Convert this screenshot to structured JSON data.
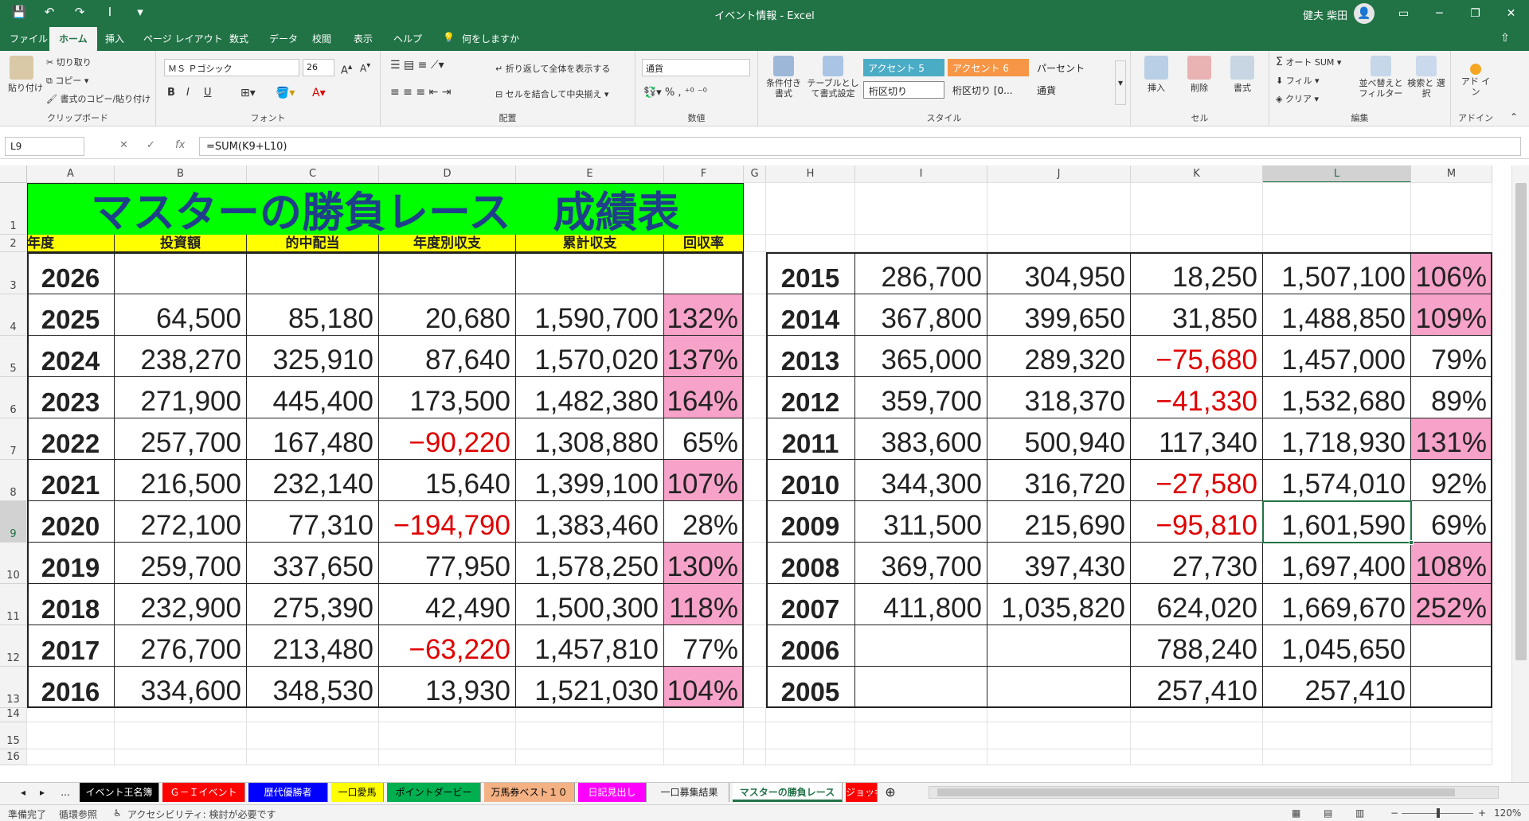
{
  "window": {
    "title": "イベント情報 - Excel",
    "user": "健夫 柴田",
    "qat": [
      "💾",
      "↶",
      "↷",
      "I",
      "▾"
    ],
    "buttons": [
      "▭",
      "─",
      "❐",
      "✕"
    ]
  },
  "tabs": [
    "ファイル",
    "ホーム",
    "挿入",
    "ページ レイアウト",
    "数式",
    "データ",
    "校閲",
    "表示",
    "ヘルプ",
    "何をしますか"
  ],
  "active_tab": "ホーム",
  "ribbon": {
    "clipboard": {
      "label": "クリップボード",
      "paste": "貼り付け",
      "cut": "切り取り",
      "copy": "コピー",
      "format_painter": "書式のコピー/貼り付け"
    },
    "font": {
      "label": "フォント",
      "name": "ＭＳ Ｐゴシック",
      "size": "26"
    },
    "alignment": {
      "label": "配置",
      "wrap": "折り返して全体を表示する",
      "merge": "セルを結合して中央揃え"
    },
    "number": {
      "label": "数値",
      "format": "通貨"
    },
    "styles": {
      "label": "スタイル",
      "conditional": "条件付き書式",
      "table": "テーブルとして書式設定",
      "cells": [
        "アクセント 5",
        "アクセント 6",
        "パーセント",
        "桁区切り",
        "桁区切り [0...",
        "通貨"
      ]
    },
    "cells": {
      "label": "セル",
      "insert": "挿入",
      "delete": "削除",
      "format": "書式"
    },
    "editing": {
      "label": "編集",
      "autosum": "オート SUM",
      "fill": "フィル",
      "clear": "クリア",
      "sort": "並べ替えと フィルター",
      "find": "検索と 選択"
    },
    "addin": {
      "label": "アドイン",
      "name": "アド イン"
    }
  },
  "formula_bar": {
    "name_box": "L9",
    "formula": "=SUM(K9+L10)",
    "fx": "fx"
  },
  "columns": [
    "A",
    "B",
    "C",
    "D",
    "E",
    "F",
    "G",
    "H",
    "I",
    "J",
    "K",
    "L",
    "M"
  ],
  "rows": [
    "1",
    "2",
    "3",
    "4",
    "5",
    "6",
    "7",
    "8",
    "9",
    "10",
    "11",
    "12",
    "13",
    "14",
    "15",
    "16"
  ],
  "sheet": {
    "title": "マスターの勝負レース　成績表",
    "headers": [
      "年度",
      "投資額",
      "的中配当",
      "年度別収支",
      "累計収支",
      "回収率"
    ],
    "left_rows": [
      {
        "year": "2026",
        "inv": "",
        "pay": "",
        "bal": "",
        "cum": "",
        "rate": "",
        "neg": false,
        "pink": false
      },
      {
        "year": "2025",
        "inv": "64,500",
        "pay": "85,180",
        "bal": "20,680",
        "cum": "1,590,700",
        "rate": "132%",
        "neg": false,
        "pink": true
      },
      {
        "year": "2024",
        "inv": "238,270",
        "pay": "325,910",
        "bal": "87,640",
        "cum": "1,570,020",
        "rate": "137%",
        "neg": false,
        "pink": true
      },
      {
        "year": "2023",
        "inv": "271,900",
        "pay": "445,400",
        "bal": "173,500",
        "cum": "1,482,380",
        "rate": "164%",
        "neg": false,
        "pink": true
      },
      {
        "year": "2022",
        "inv": "257,700",
        "pay": "167,480",
        "bal": "−90,220",
        "cum": "1,308,880",
        "rate": "65%",
        "neg": true,
        "pink": false
      },
      {
        "year": "2021",
        "inv": "216,500",
        "pay": "232,140",
        "bal": "15,640",
        "cum": "1,399,100",
        "rate": "107%",
        "neg": false,
        "pink": true
      },
      {
        "year": "2020",
        "inv": "272,100",
        "pay": "77,310",
        "bal": "−194,790",
        "cum": "1,383,460",
        "rate": "28%",
        "neg": true,
        "pink": false
      },
      {
        "year": "2019",
        "inv": "259,700",
        "pay": "337,650",
        "bal": "77,950",
        "cum": "1,578,250",
        "rate": "130%",
        "neg": false,
        "pink": true
      },
      {
        "year": "2018",
        "inv": "232,900",
        "pay": "275,390",
        "bal": "42,490",
        "cum": "1,500,300",
        "rate": "118%",
        "neg": false,
        "pink": true
      },
      {
        "year": "2017",
        "inv": "276,700",
        "pay": "213,480",
        "bal": "−63,220",
        "cum": "1,457,810",
        "rate": "77%",
        "neg": true,
        "pink": false
      },
      {
        "year": "2016",
        "inv": "334,600",
        "pay": "348,530",
        "bal": "13,930",
        "cum": "1,521,030",
        "rate": "104%",
        "neg": false,
        "pink": true
      }
    ],
    "right_rows": [
      {
        "year": "2015",
        "inv": "286,700",
        "pay": "304,950",
        "bal": "18,250",
        "cum": "1,507,100",
        "rate": "106%",
        "neg": false,
        "pink": true
      },
      {
        "year": "2014",
        "inv": "367,800",
        "pay": "399,650",
        "bal": "31,850",
        "cum": "1,488,850",
        "rate": "109%",
        "neg": false,
        "pink": true
      },
      {
        "year": "2013",
        "inv": "365,000",
        "pay": "289,320",
        "bal": "−75,680",
        "cum": "1,457,000",
        "rate": "79%",
        "neg": true,
        "pink": false
      },
      {
        "year": "2012",
        "inv": "359,700",
        "pay": "318,370",
        "bal": "−41,330",
        "cum": "1,532,680",
        "rate": "89%",
        "neg": true,
        "pink": false
      },
      {
        "year": "2011",
        "inv": "383,600",
        "pay": "500,940",
        "bal": "117,340",
        "cum": "1,718,930",
        "rate": "131%",
        "neg": false,
        "pink": true
      },
      {
        "year": "2010",
        "inv": "344,300",
        "pay": "316,720",
        "bal": "−27,580",
        "cum": "1,574,010",
        "rate": "92%",
        "neg": true,
        "pink": false
      },
      {
        "year": "2009",
        "inv": "311,500",
        "pay": "215,690",
        "bal": "−95,810",
        "cum": "1,601,590",
        "rate": "69%",
        "neg": true,
        "pink": false
      },
      {
        "year": "2008",
        "inv": "369,700",
        "pay": "397,430",
        "bal": "27,730",
        "cum": "1,697,400",
        "rate": "108%",
        "neg": false,
        "pink": true
      },
      {
        "year": "2007",
        "inv": "411,800",
        "pay": "1,035,820",
        "bal": "624,020",
        "cum": "1,669,670",
        "rate": "252%",
        "neg": false,
        "pink": true
      },
      {
        "year": "2006",
        "inv": "",
        "pay": "",
        "bal": "788,240",
        "cum": "1,045,650",
        "rate": "",
        "neg": false,
        "pink": false
      },
      {
        "year": "2005",
        "inv": "",
        "pay": "",
        "bal": "257,410",
        "cum": "257,410",
        "rate": "",
        "neg": false,
        "pink": false
      }
    ]
  },
  "sheet_tabs": [
    {
      "name": "イベント王名簿",
      "bg": "#000000",
      "fg": "#ffffff"
    },
    {
      "name": "Ｇ－Ｉイベント",
      "bg": "#ff0000",
      "fg": "#ffffff"
    },
    {
      "name": "歴代優勝者",
      "bg": "#0000ff",
      "fg": "#ffffff"
    },
    {
      "name": "一口愛馬",
      "bg": "#ffff00",
      "fg": "#000000"
    },
    {
      "name": "ポイントダービー",
      "bg": "#00b050",
      "fg": "#000000"
    },
    {
      "name": "万馬券ベスト１０",
      "bg": "#f4b183",
      "fg": "#000000"
    },
    {
      "name": "日記見出し",
      "bg": "#ff00ff",
      "fg": "#ffffff"
    },
    {
      "name": "一口募集結果",
      "bg": "#f3f3f3",
      "fg": "#222222"
    },
    {
      "name": "マスターの勝負レース",
      "bg": "#ffffff",
      "fg": "#217346"
    },
    {
      "name": "ジョッキ",
      "bg": "#ff0000",
      "fg": "#ffffff"
    }
  ],
  "sheet_nav": [
    "◂",
    "▸",
    "..."
  ],
  "status": {
    "ready": "準備完了",
    "circular": "循環参照",
    "accessibility": "アクセシビリティ: 検討が必要です",
    "zoom": "120%",
    "zoom_minus": "−",
    "zoom_plus": "+"
  },
  "colors": {
    "accent": "#217346",
    "title_bg": "#00ff00",
    "header_bg": "#ffff00",
    "pink": "#f6a2c9",
    "negative": "#e00000"
  }
}
